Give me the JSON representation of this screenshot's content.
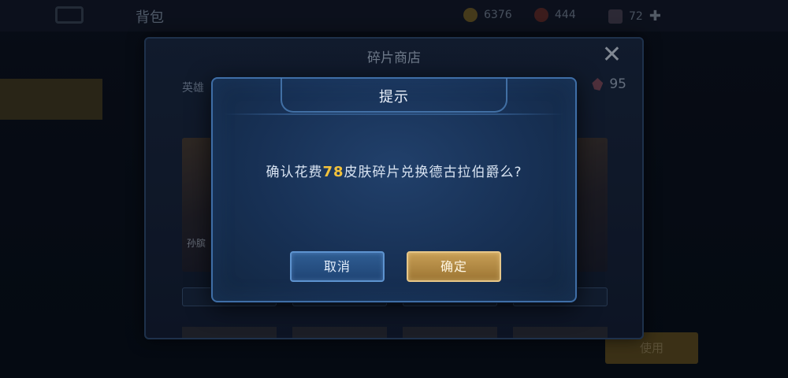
{
  "topbar": {
    "title": "背包",
    "subtitle": "",
    "currency1": "6376",
    "currency2": "444",
    "currency3": "72"
  },
  "sidebar": {
    "items": [
      "",
      "",
      "",
      "",
      "",
      "",
      ""
    ]
  },
  "shop": {
    "title": "碎片商店",
    "tab_hero": "英雄",
    "shard_count": "95",
    "cards": [
      {
        "name": "孙膑"
      },
      {
        "name": ""
      },
      {
        "name": ""
      },
      {
        "name": ""
      }
    ]
  },
  "right_panel": {
    "use_label": "使用"
  },
  "dialog": {
    "title": "提示",
    "msg_before": "确认花费",
    "msg_number": "78",
    "msg_after": "皮肤碎片兑换德古拉伯爵么?",
    "cancel_label": "取消",
    "confirm_label": "确定"
  },
  "colors": {
    "accent_gold": "#f2c23c",
    "dialog_bg": "#173054",
    "confirm_button": "#c79e55",
    "cancel_button": "#2f5d93"
  }
}
